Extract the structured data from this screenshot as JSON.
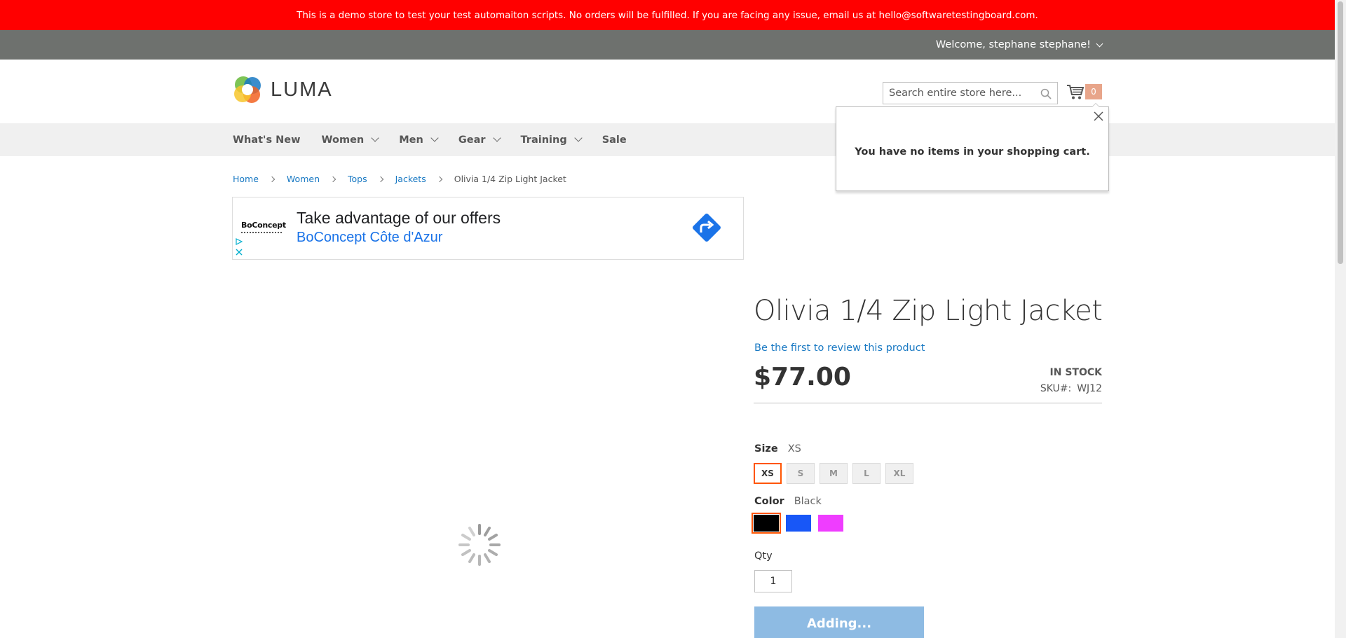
{
  "banner": {
    "text": "This is a demo store to test your test automaiton scripts. No orders will be fulfilled. If you are facing any issue, email us at hello@softwaretestingboard.com."
  },
  "header": {
    "welcome": "Welcome, stephane stephane!"
  },
  "logo": {
    "text": "LUMA"
  },
  "search": {
    "placeholder": "Search entire store here..."
  },
  "cart": {
    "count": "0"
  },
  "minicart": {
    "empty_message": "You have no items in your shopping cart."
  },
  "nav": {
    "items": [
      {
        "label": "What's New"
      },
      {
        "label": "Women"
      },
      {
        "label": "Men"
      },
      {
        "label": "Gear"
      },
      {
        "label": "Training"
      },
      {
        "label": "Sale"
      }
    ]
  },
  "breadcrumbs": {
    "items": [
      "Home",
      "Women",
      "Tops",
      "Jackets"
    ],
    "current": "Olivia 1/4 Zip Light Jacket"
  },
  "ad": {
    "logo": "BoConcept",
    "headline": "Take advantage of our offers",
    "advertiser": "BoConcept Côte d'Azur"
  },
  "product": {
    "title": "Olivia 1/4 Zip Light Jacket",
    "review_link": "Be the first to review this product",
    "price": "$77.00",
    "stock": "IN STOCK",
    "sku_label": "SKU#:",
    "sku": "WJ12"
  },
  "options": {
    "size_label": "Size",
    "size_selected": "XS",
    "sizes": [
      "XS",
      "S",
      "M",
      "L",
      "XL"
    ],
    "color_label": "Color",
    "color_selected": "Black",
    "colors": [
      "#000000",
      "#1857f7",
      "#ef3dff"
    ]
  },
  "qty": {
    "label": "Qty",
    "value": "1"
  },
  "add_button": {
    "label": "Adding..."
  },
  "colors": {
    "banner": "#ff0000",
    "header": "#6e716e",
    "link": "#1979c3",
    "swatch_selected": "#ff5501",
    "button": "#8ebbe3"
  }
}
